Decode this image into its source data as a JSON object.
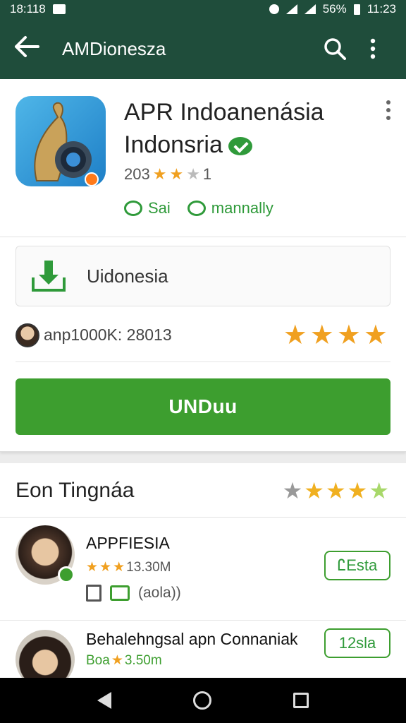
{
  "status_bar": {
    "time_left": "18:118",
    "battery_percent": "56%",
    "time_right": "11:23"
  },
  "app_bar": {
    "title": "AMDionesza",
    "back_icon": "arrow-left-icon",
    "search_icon": "search-icon",
    "more_icon": "more-vert-icon"
  },
  "app": {
    "name_line1": "APR Indoanenásia",
    "name_line2": "Indonsria",
    "rating_count": "203",
    "rating_tail": "1",
    "chip1": "Sai",
    "chip2": "mannally"
  },
  "download": {
    "label": "Uidonesia"
  },
  "meta": {
    "downloads_text": "anp1000K: 28013",
    "stars": "★★★★"
  },
  "install_button": {
    "label": "UNDuu"
  },
  "section": {
    "title": "Eon Tingnáa",
    "items": [
      {
        "name": "APPFIESIA",
        "meta": "13.30M",
        "extra": "(aola))",
        "pill": "ᏝEsta"
      },
      {
        "name": "Behalehngsal apn Connaniak",
        "meta_prefix": "Boa",
        "meta_suffix": "3.50m",
        "pill": "12sla"
      }
    ]
  },
  "colors": {
    "appbar": "#1f4d3b",
    "accent": "#3d9e2f",
    "star": "#f0a020"
  }
}
